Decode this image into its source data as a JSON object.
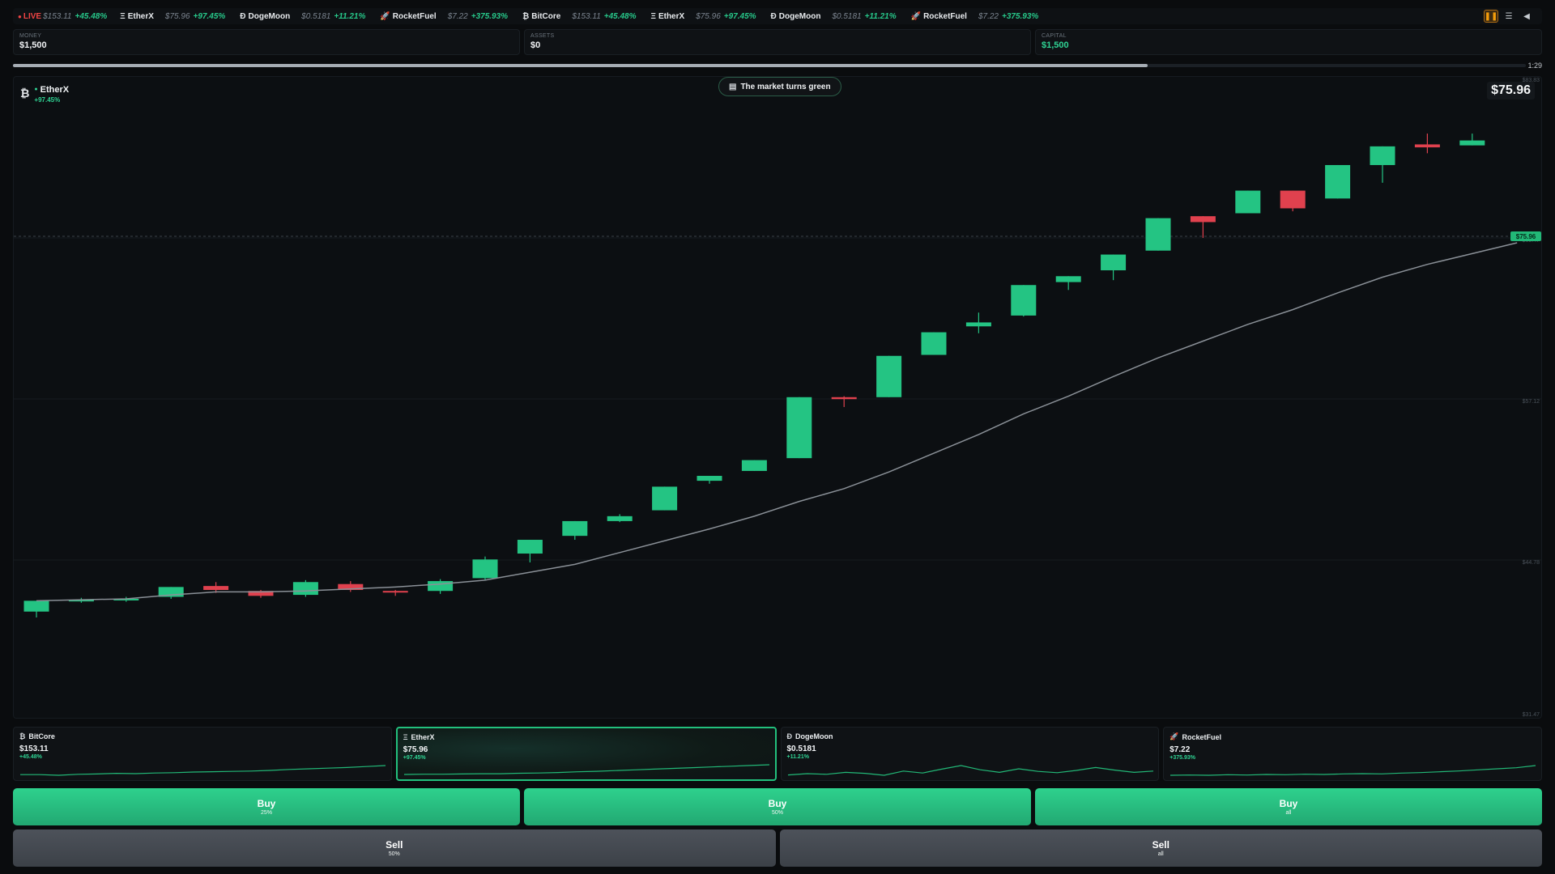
{
  "ticker": {
    "live_label": "LIVE",
    "items": [
      {
        "icon": "",
        "name": "",
        "price": "$153.11",
        "change": "+45.48%"
      },
      {
        "icon": "Ξ",
        "name": "EtherX",
        "price": "$75.96",
        "change": "+97.45%"
      },
      {
        "icon": "Ð",
        "name": "DogeMoon",
        "price": "$0.5181",
        "change": "+11.21%"
      },
      {
        "icon": "🚀",
        "name": "RocketFuel",
        "price": "$7.22",
        "change": "+375.93%"
      },
      {
        "icon": "₿",
        "name": "BitCore",
        "price": "$153.11",
        "change": "+45.48%"
      },
      {
        "icon": "Ξ",
        "name": "EtherX",
        "price": "$75.96",
        "change": "+97.45%"
      },
      {
        "icon": "Ð",
        "name": "DogeMoon",
        "price": "$0.5181",
        "change": "+11.21%"
      },
      {
        "icon": "🚀",
        "name": "RocketFuel",
        "price": "$7.22",
        "change": "+375.93%"
      }
    ],
    "controls": [
      "pause-icon",
      "menu-icon",
      "sound-icon"
    ]
  },
  "stats": {
    "money_label": "MONEY",
    "money_value": "$1,500",
    "assets_label": "ASSETS",
    "assets_value": "$0",
    "capital_label": "CAPITAL",
    "capital_value": "$1,500"
  },
  "timer": {
    "text": "1:29",
    "progress": 0.75
  },
  "chart": {
    "icon": "₿",
    "name": "EtherX",
    "change": "+97.45%",
    "news": "The market turns green",
    "news_icon": "newspaper-icon",
    "price": "$75.96",
    "current_price_tag": "$75.96"
  },
  "chart_data": {
    "type": "candlestick",
    "title": "",
    "ylim": [
      31.47,
      83.83
    ],
    "ytick_labels": [
      "$83.83",
      "$69.47",
      "$57.12",
      "$44.78",
      "$31.47"
    ],
    "current_price": 75.96,
    "colors": {
      "up": "#24c483",
      "down": "#e0414e",
      "ma": "#8a9097"
    },
    "candles": [
      {
        "o": 37.8,
        "h": 38.9,
        "l": 37.2,
        "c": 38.9
      },
      {
        "o": 38.9,
        "h": 39.2,
        "l": 38.7,
        "c": 39.0
      },
      {
        "o": 39.0,
        "h": 39.3,
        "l": 38.8,
        "c": 39.1
      },
      {
        "o": 39.3,
        "h": 40.3,
        "l": 39.1,
        "c": 40.3
      },
      {
        "o": 40.4,
        "h": 40.8,
        "l": 39.7,
        "c": 40.0
      },
      {
        "o": 39.9,
        "h": 40.0,
        "l": 39.2,
        "c": 39.4
      },
      {
        "o": 39.5,
        "h": 41.0,
        "l": 39.3,
        "c": 40.8
      },
      {
        "o": 40.6,
        "h": 40.9,
        "l": 39.8,
        "c": 40.0
      },
      {
        "o": 39.9,
        "h": 40.0,
        "l": 39.4,
        "c": 39.8
      },
      {
        "o": 39.9,
        "h": 41.1,
        "l": 39.6,
        "c": 40.9
      },
      {
        "o": 41.2,
        "h": 43.4,
        "l": 41.0,
        "c": 43.1
      },
      {
        "o": 43.7,
        "h": 45.1,
        "l": 42.8,
        "c": 45.1
      },
      {
        "o": 45.5,
        "h": 47.0,
        "l": 45.1,
        "c": 47.0
      },
      {
        "o": 47.0,
        "h": 47.7,
        "l": 46.9,
        "c": 47.5
      },
      {
        "o": 48.1,
        "h": 50.5,
        "l": 48.1,
        "c": 50.5
      },
      {
        "o": 51.1,
        "h": 51.6,
        "l": 50.8,
        "c": 51.6
      },
      {
        "o": 52.1,
        "h": 53.2,
        "l": 52.1,
        "c": 53.2
      },
      {
        "o": 53.4,
        "h": 59.6,
        "l": 53.4,
        "c": 59.6
      },
      {
        "o": 59.6,
        "h": 59.7,
        "l": 58.6,
        "c": 59.4
      },
      {
        "o": 59.6,
        "h": 63.8,
        "l": 59.6,
        "c": 63.8
      },
      {
        "o": 63.9,
        "h": 66.2,
        "l": 63.9,
        "c": 66.2
      },
      {
        "o": 66.8,
        "h": 68.2,
        "l": 66.1,
        "c": 67.2
      },
      {
        "o": 67.9,
        "h": 71.0,
        "l": 67.8,
        "c": 71.0
      },
      {
        "o": 71.3,
        "h": 71.9,
        "l": 70.5,
        "c": 71.9
      },
      {
        "o": 72.5,
        "h": 74.1,
        "l": 71.5,
        "c": 74.1
      },
      {
        "o": 74.5,
        "h": 77.8,
        "l": 74.5,
        "c": 77.8
      },
      {
        "o": 78.0,
        "h": 78.0,
        "l": 75.8,
        "c": 77.4
      },
      {
        "o": 78.3,
        "h": 80.6,
        "l": 78.3,
        "c": 80.6
      },
      {
        "o": 80.6,
        "h": 80.6,
        "l": 78.5,
        "c": 78.8
      },
      {
        "o": 79.8,
        "h": 83.2,
        "l": 79.8,
        "c": 83.2
      },
      {
        "o": 83.2,
        "h": 85.1,
        "l": 81.4,
        "c": 85.1
      },
      {
        "o": 85.3,
        "h": 86.4,
        "l": 84.4,
        "c": 85.0
      },
      {
        "o": 85.2,
        "h": 86.4,
        "l": 85.2,
        "c": 85.7
      }
    ],
    "moving_average": [
      38.9,
      39.0,
      39.1,
      39.5,
      39.8,
      39.8,
      39.9,
      40.1,
      40.3,
      40.6,
      41.0,
      41.8,
      42.6,
      43.8,
      45.0,
      46.2,
      47.5,
      49.0,
      50.3,
      52.0,
      53.9,
      55.8,
      57.9,
      59.7,
      61.7,
      63.6,
      65.3,
      67.0,
      68.5,
      70.2,
      71.8,
      73.1,
      74.2,
      75.3
    ]
  },
  "cards": [
    {
      "icon": "₿",
      "name": "BitCore",
      "price": "$153.11",
      "change": "+45.48%",
      "spark": [
        3,
        3,
        2.8,
        3.1,
        3.2,
        3.4,
        3.3,
        3.5,
        3.6,
        3.8,
        3.9,
        4.0,
        4.1,
        4.3,
        4.6,
        4.8,
        5.0,
        5.2,
        5.5,
        5.8
      ]
    },
    {
      "icon": "Ξ",
      "name": "EtherX",
      "price": "$75.96",
      "change": "+97.45%",
      "spark": [
        2,
        2.1,
        2.1,
        2.2,
        2.3,
        2.3,
        2.5,
        2.6,
        2.8,
        3.1,
        3.3,
        3.6,
        3.9,
        4.2,
        4.5,
        4.8,
        5.1,
        5.4,
        5.7,
        6
      ]
    },
    {
      "icon": "Ð",
      "name": "DogeMoon",
      "price": "$0.5181",
      "change": "+11.21%",
      "spark": [
        3,
        3.4,
        3.2,
        3.8,
        3.5,
        2.9,
        4.2,
        3.6,
        4.8,
        5.9,
        4.6,
        3.8,
        4.9,
        4.1,
        3.7,
        4.4,
        5.3,
        4.5,
        3.8,
        4.2
      ]
    },
    {
      "icon": "🚀",
      "name": "RocketFuel",
      "price": "$7.22",
      "change": "+375.93%",
      "spark": [
        2,
        2.1,
        2.0,
        2.2,
        2.1,
        2.3,
        2.2,
        2.4,
        2.3,
        2.5,
        2.6,
        2.5,
        2.8,
        3.0,
        3.3,
        3.6,
        4.0,
        4.4,
        4.8,
        5.6
      ]
    }
  ],
  "buttons": {
    "buy": [
      {
        "label": "Buy",
        "sub": "25%"
      },
      {
        "label": "Buy",
        "sub": "50%"
      },
      {
        "label": "Buy",
        "sub": "all"
      }
    ],
    "sell": [
      {
        "label": "Sell",
        "sub": "50%"
      },
      {
        "label": "Sell",
        "sub": "all"
      }
    ]
  }
}
